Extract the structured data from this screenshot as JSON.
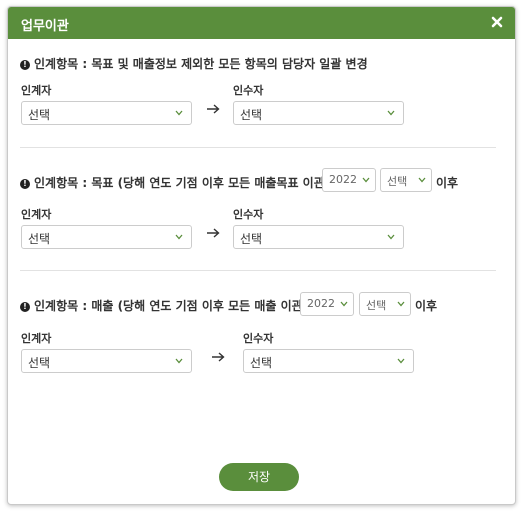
{
  "dialog": {
    "title": "업무이관",
    "close_icon": "close-icon",
    "save_label": "저장"
  },
  "colors": {
    "header_bg": "#5a8e3c",
    "button_bg": "#5a8e3c"
  },
  "sections": [
    {
      "title": "인계항목 : 목표 및 매출정보 제외한 모든 항목의 담당자 일괄 변경",
      "from_label": "인계자",
      "to_label": "인수자",
      "from_value": "선택",
      "to_value": "선택"
    },
    {
      "title": "인계항목 : 목표 (당해 연도 기점 이후 모든 매출목표 이관)",
      "year_value": "2022",
      "month_value": "선택",
      "after_text": "이후",
      "from_label": "인계자",
      "to_label": "인수자",
      "from_value": "선택",
      "to_value": "선택"
    },
    {
      "title": "인계항목 : 매출 (당해 연도 기점 이후 모든 매출 이관)",
      "year_value": "2022",
      "month_value": "선택",
      "after_text": "이후",
      "from_label": "인계자",
      "to_label": "인수자",
      "from_value": "선택",
      "to_value": "선택"
    }
  ]
}
